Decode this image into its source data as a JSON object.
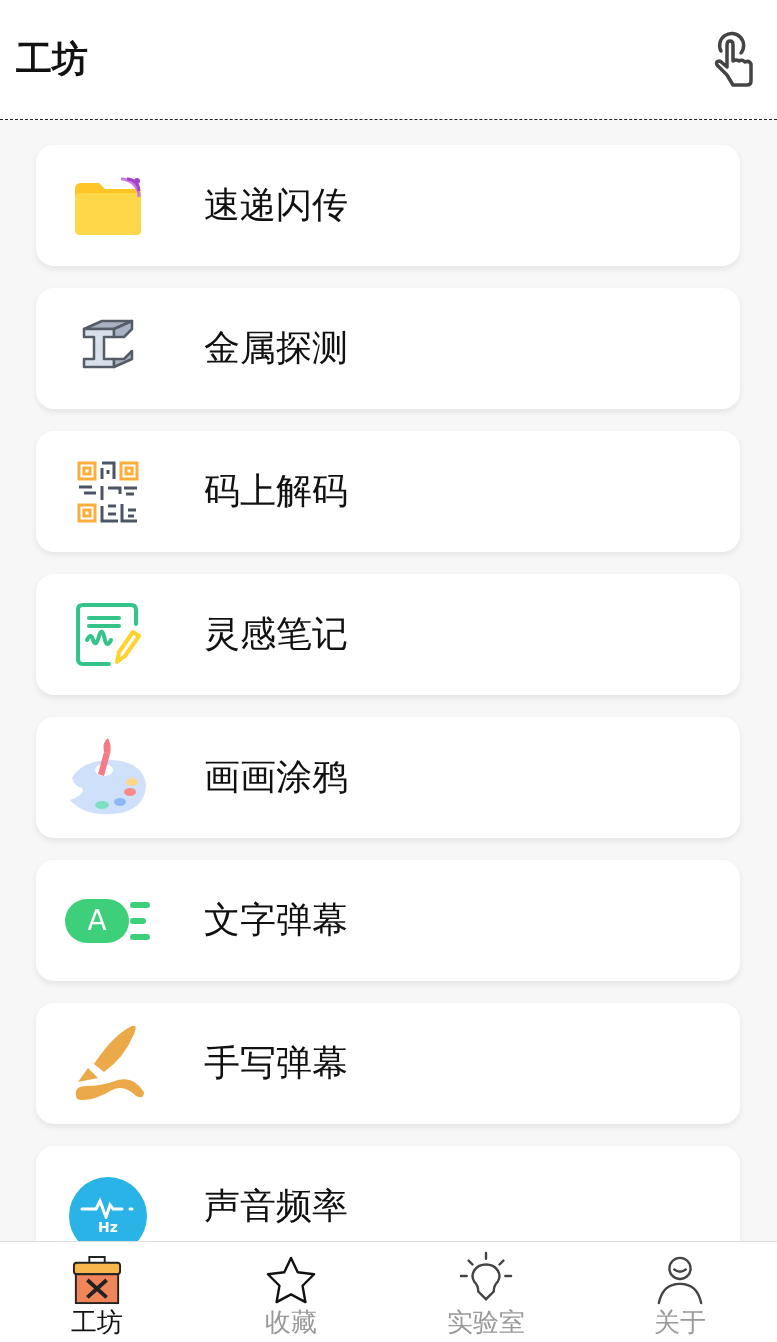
{
  "header": {
    "title": "工坊"
  },
  "items": [
    {
      "kind": "folder",
      "label": "速递闪传"
    },
    {
      "kind": "steel",
      "label": "金属探测"
    },
    {
      "kind": "qr",
      "label": "码上解码"
    },
    {
      "kind": "note",
      "label": "灵感笔记"
    },
    {
      "kind": "palette",
      "label": "画画涂鸦"
    },
    {
      "kind": "barrage",
      "label": "文字弹幕",
      "icon_text": "A"
    },
    {
      "kind": "brush",
      "label": "手写弹幕"
    },
    {
      "kind": "sound",
      "label": "声音频率",
      "icon_text": "Hz"
    }
  ],
  "tabs": [
    {
      "kind": "toolbox",
      "label": "工坊",
      "selected": true
    },
    {
      "kind": "star",
      "label": "收藏",
      "selected": false
    },
    {
      "kind": "bulb",
      "label": "实验室",
      "selected": false
    },
    {
      "kind": "person",
      "label": "关于",
      "selected": false
    }
  ]
}
